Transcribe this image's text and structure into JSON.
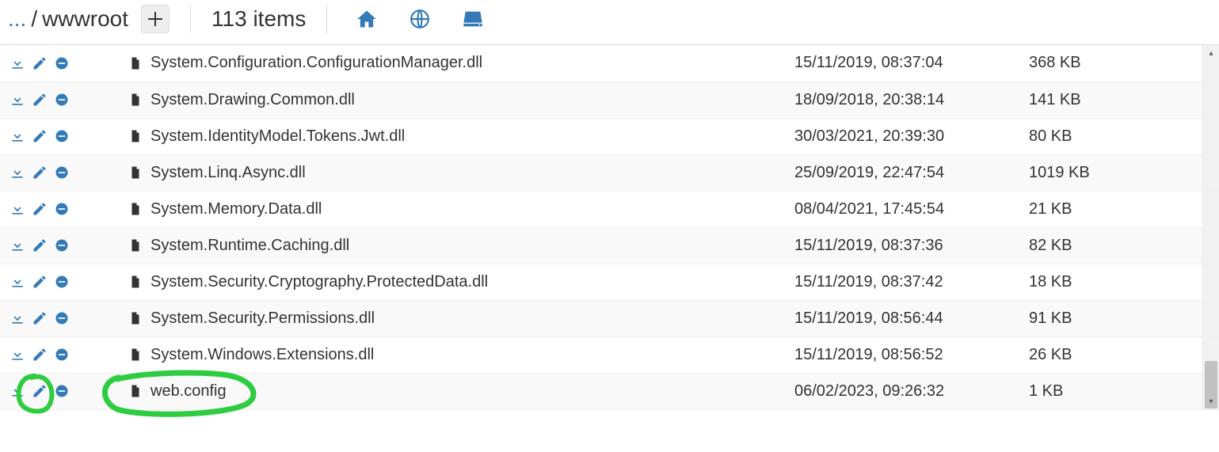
{
  "header": {
    "breadcrumb": {
      "ellipsis": "...",
      "sep": "/",
      "folder": "wwwroot"
    },
    "item_count": "113 items"
  },
  "files": [
    {
      "name": "System.Configuration.ConfigurationManager.dll",
      "date": "15/11/2019, 08:37:04",
      "size": "368 KB"
    },
    {
      "name": "System.Drawing.Common.dll",
      "date": "18/09/2018, 20:38:14",
      "size": "141 KB"
    },
    {
      "name": "System.IdentityModel.Tokens.Jwt.dll",
      "date": "30/03/2021, 20:39:30",
      "size": "80 KB"
    },
    {
      "name": "System.Linq.Async.dll",
      "date": "25/09/2019, 22:47:54",
      "size": "1019 KB"
    },
    {
      "name": "System.Memory.Data.dll",
      "date": "08/04/2021, 17:45:54",
      "size": "21 KB"
    },
    {
      "name": "System.Runtime.Caching.dll",
      "date": "15/11/2019, 08:37:36",
      "size": "82 KB"
    },
    {
      "name": "System.Security.Cryptography.ProtectedData.dll",
      "date": "15/11/2019, 08:37:42",
      "size": "18 KB"
    },
    {
      "name": "System.Security.Permissions.dll",
      "date": "15/11/2019, 08:56:44",
      "size": "91 KB"
    },
    {
      "name": "System.Windows.Extensions.dll",
      "date": "15/11/2019, 08:56:52",
      "size": "26 KB"
    },
    {
      "name": "web.config",
      "date": "06/02/2023, 09:26:32",
      "size": "1 KB"
    }
  ],
  "colors": {
    "accent": "#337ab7",
    "highlight": "#2ecc40"
  }
}
